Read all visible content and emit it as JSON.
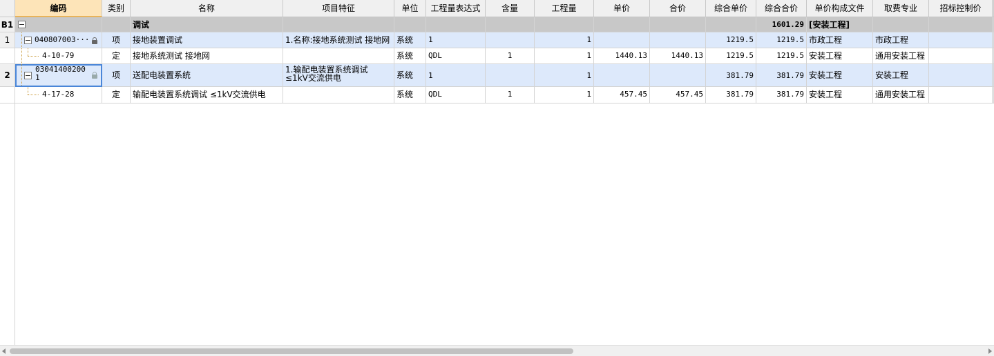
{
  "columns": {
    "code": "编码",
    "type": "类别",
    "name": "名称",
    "features": "项目特征",
    "unit": "单位",
    "expr": "工程量表达式",
    "content": "含量",
    "qty": "工程量",
    "unit_price": "单价",
    "total_price": "合价",
    "comp_unit_price": "综合单价",
    "comp_total": "综合合价",
    "price_file": "单价构成文件",
    "fee_specialty": "取费专业",
    "bid_control": "招标控制价"
  },
  "rows": [
    {
      "rownum": "B1",
      "code": "",
      "type": "",
      "name": "调试",
      "features": "",
      "unit": "",
      "expr": "",
      "content": "",
      "qty": "",
      "unit_price": "",
      "total_price": "",
      "comp_unit_price": "",
      "comp_total": "1601.29",
      "price_file": "[安装工程]",
      "fee_specialty": "",
      "bid_control": ""
    },
    {
      "rownum": "1",
      "code": "040807003···",
      "type": "项",
      "name": "接地装置调试",
      "features": "1.名称:接地系统测试 接地网",
      "unit": "系统",
      "expr": "1",
      "content": "",
      "qty": "1",
      "unit_price": "",
      "total_price": "",
      "comp_unit_price": "1219.5",
      "comp_total": "1219.5",
      "price_file": "市政工程",
      "fee_specialty": "市政工程",
      "bid_control": ""
    },
    {
      "rownum": "",
      "code": "4-10-79",
      "type": "定",
      "name": "接地系统测试 接地网",
      "features": "",
      "unit": "系统",
      "expr": "QDL",
      "content": "1",
      "qty": "1",
      "unit_price": "1440.13",
      "total_price": "1440.13",
      "comp_unit_price": "1219.5",
      "comp_total": "1219.5",
      "price_file": "安装工程",
      "fee_specialty": "通用安装工程",
      "bid_control": ""
    },
    {
      "rownum": "2",
      "code": "030414002001",
      "type": "项",
      "name": "送配电装置系统",
      "features": "1.输配电装置系统调试 ≤1kV交流供电",
      "unit": "系统",
      "expr": "1",
      "content": "",
      "qty": "1",
      "unit_price": "",
      "total_price": "",
      "comp_unit_price": "381.79",
      "comp_total": "381.79",
      "price_file": "安装工程",
      "fee_specialty": "安装工程",
      "bid_control": ""
    },
    {
      "rownum": "",
      "code": "4-17-28",
      "type": "定",
      "name": "输配电装置系统调试 ≤1kV交流供电",
      "features": "",
      "unit": "系统",
      "expr": "QDL",
      "content": "1",
      "qty": "1",
      "unit_price": "457.45",
      "total_price": "457.45",
      "comp_unit_price": "381.79",
      "comp_total": "381.79",
      "price_file": "安装工程",
      "fee_specialty": "通用安装工程",
      "bid_control": ""
    }
  ]
}
